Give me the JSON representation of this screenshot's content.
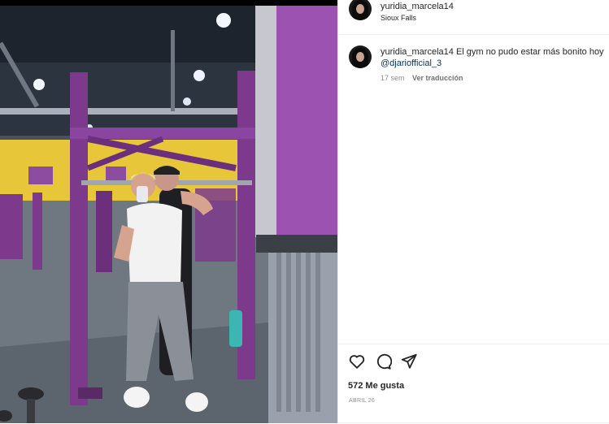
{
  "post": {
    "username": "yuridia_marcela14",
    "location": "Sioux Falls",
    "photo_alt": "Two women taking a mirror selfie in a gym with purple equipment"
  },
  "caption": {
    "username": "yuridia_marcela14",
    "text": "El gym no pudo estar más bonito hoy",
    "mention": "@djariofficial_3",
    "age": "17 sem",
    "translate_label": "Ver traducción"
  },
  "actions": {
    "like_icon": "heart-icon",
    "comment_icon": "comment-icon",
    "share_icon": "share-icon"
  },
  "stats": {
    "likes": "572 Me gusta",
    "date": "ABRIL 26"
  },
  "colors": {
    "gym_purple": "#7d3a8c",
    "wall_yellow": "#e7c63a",
    "mention_blue": "#00376b"
  }
}
